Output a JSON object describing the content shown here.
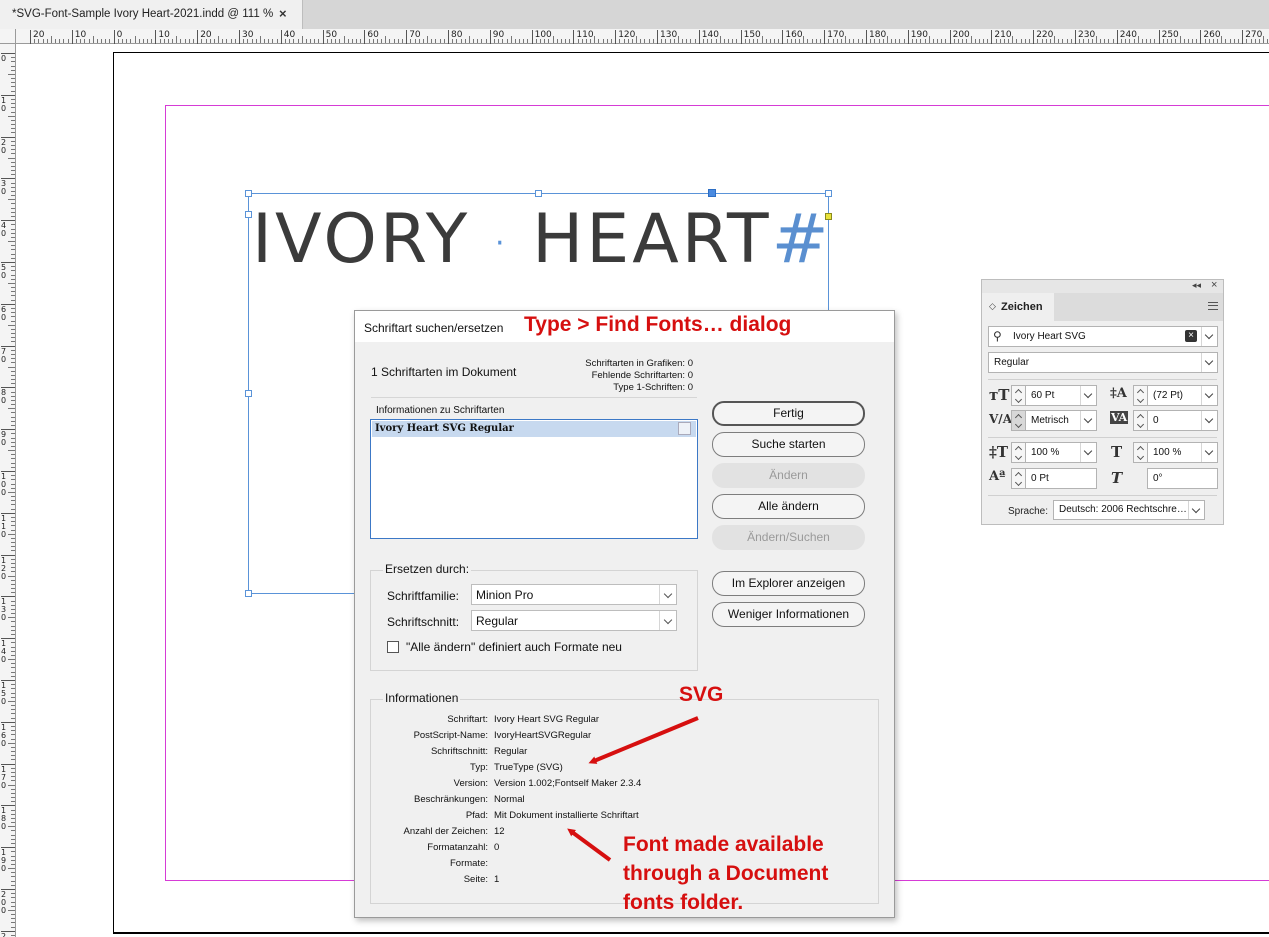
{
  "document_tab": {
    "title": "*SVG-Font-Sample Ivory Heart-2021.indd @ 111 %",
    "close": "×"
  },
  "ruler": {
    "h_labels": [
      "20",
      "10",
      "0",
      "10",
      "20",
      "30",
      "40",
      "50",
      "60",
      "70",
      "80",
      "90",
      "100",
      "110",
      "120",
      "130",
      "140",
      "150",
      "160",
      "170",
      "180",
      "190",
      "200",
      "210",
      "220",
      "230",
      "240",
      "250",
      "260",
      "270"
    ],
    "v_labels": [
      "0",
      "10",
      "20",
      "30",
      "40",
      "50",
      "60",
      "70",
      "80",
      "90",
      "100",
      "110",
      "120",
      "130",
      "140",
      "150",
      "160",
      "170",
      "180",
      "190",
      "200",
      "210"
    ]
  },
  "canvas": {
    "headline": "IVORY",
    "headline_dot": "·",
    "headline_2": "HEART",
    "headline_hash": "#"
  },
  "annotations": {
    "dialog_caption": "Type > Find Fonts… dialog",
    "svg_caption": "SVG",
    "note_line1": "Font made available",
    "note_line2": "through a Document",
    "note_line3": "fonts folder."
  },
  "dialog": {
    "title": "Schriftart suchen/ersetzen",
    "fonts_in_document": "1 Schriftarten im Dokument",
    "stats": {
      "graphics": "Schriftarten in Grafiken: 0",
      "missing": "Fehlende Schriftarten: 0",
      "type1": "Type 1-Schriften: 0"
    },
    "info_label": "Informationen zu Schriftarten",
    "font_list": [
      "Ivory Heart SVG Regular"
    ],
    "buttons": {
      "done": "Fertig",
      "find_first": "Suche starten",
      "change": "Ändern",
      "change_all": "Alle ändern",
      "change_find": "Ändern/Suchen",
      "reveal": "Im Explorer anzeigen",
      "less_info": "Weniger Informationen"
    },
    "replace": {
      "group_label": "Ersetzen durch:",
      "family_label": "Schriftfamilie:",
      "family_value": "Minion Pro",
      "style_label": "Schriftschnitt:",
      "style_value": "Regular",
      "redefine_label": "\"Alle ändern\" definiert auch Formate neu",
      "redefine_checked": false
    },
    "information": {
      "group_label": "Informationen",
      "rows": [
        {
          "label": "Schriftart:",
          "value": "Ivory Heart SVG Regular"
        },
        {
          "label": "PostScript-Name:",
          "value": "IvoryHeartSVGRegular"
        },
        {
          "label": "Schriftschnitt:",
          "value": "Regular"
        },
        {
          "label": "Typ:",
          "value": "TrueType (SVG)"
        },
        {
          "label": "Version:",
          "value": "Version 1.002;Fontself Maker 2.3.4"
        },
        {
          "label": "Beschränkungen:",
          "value": "Normal"
        },
        {
          "label": "Pfad:",
          "value": "Mit Dokument installierte Schriftart"
        },
        {
          "label": "Anzahl der Zeichen:",
          "value": "12"
        },
        {
          "label": "Formatanzahl:",
          "value": "0"
        },
        {
          "label": "Formate:",
          "value": ""
        },
        {
          "label": "Seite:",
          "value": "1"
        }
      ]
    }
  },
  "character_panel": {
    "collapse": "◂◂",
    "close": "×",
    "tab_label": "Zeichen",
    "font_family": "Ivory Heart SVG",
    "font_style": "Regular",
    "size": "60 Pt",
    "leading": "(72 Pt)",
    "kerning": "Metrisch",
    "tracking": "0",
    "vertical_scale": "100 %",
    "horizontal_scale": "100 %",
    "baseline_shift": "0 Pt",
    "skew": "0°",
    "language_label": "Sprache:",
    "language": "Deutsch: 2006 Rechtschre…"
  },
  "colors": {
    "annotation_red": "#d60f0f",
    "frame_blue": "#5a93d8",
    "margin_magenta": "#d63bd6",
    "selection_blue": "#c7d9ef"
  }
}
